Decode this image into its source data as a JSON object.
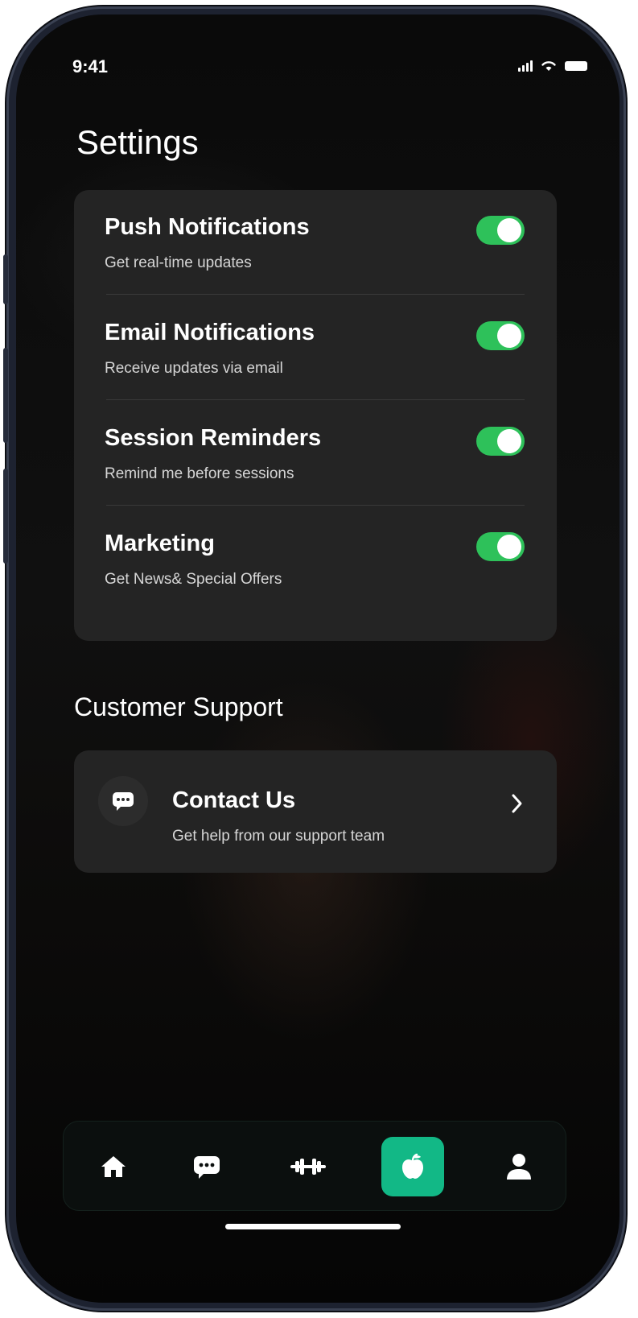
{
  "status_bar": {
    "time": "9:41"
  },
  "page": {
    "title": "Settings"
  },
  "settings": [
    {
      "label": "Push Notifications",
      "description": "Get real-time updates",
      "enabled": true
    },
    {
      "label": "Email Notifications",
      "description": "Receive updates via email",
      "enabled": true
    },
    {
      "label": "Session Reminders",
      "description": "Remind me before sessions",
      "enabled": true
    },
    {
      "label": "Marketing",
      "description": "Get News& Special Offers",
      "enabled": true
    }
  ],
  "support": {
    "heading": "Customer Support",
    "contact": {
      "title": "Contact Us",
      "description": "Get help from our support team",
      "icon": "chat-icon"
    }
  },
  "tabbar": {
    "items": [
      {
        "icon": "home-icon",
        "active": false
      },
      {
        "icon": "chat-icon",
        "active": false
      },
      {
        "icon": "dumbbell-icon",
        "active": false
      },
      {
        "icon": "apple-icon",
        "active": true
      },
      {
        "icon": "profile-icon",
        "active": false
      }
    ]
  },
  "colors": {
    "toggle_on": "#2ec15a",
    "accent": "#12b886",
    "card": "#242424",
    "background": "#0a0a0a"
  }
}
